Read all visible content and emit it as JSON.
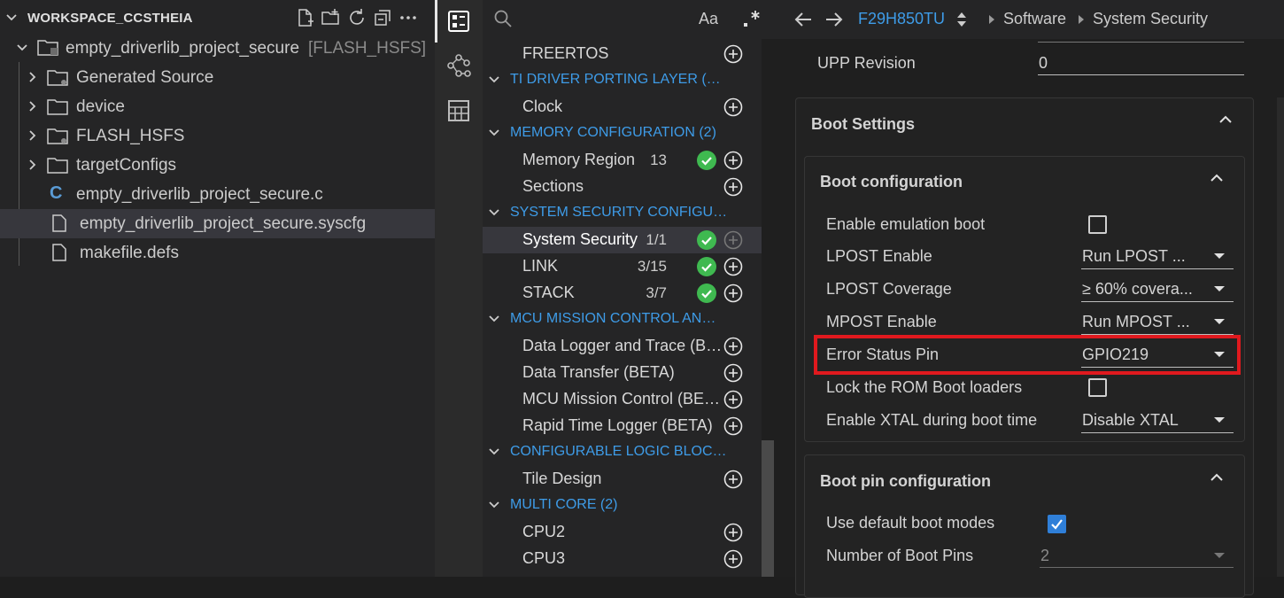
{
  "explorer": {
    "title": "WORKSPACE_CCSTHEIA",
    "project": {
      "name": "empty_driverlib_project_secure",
      "config": "[FLASH_HSFS]"
    },
    "items": [
      {
        "label": "Generated Source",
        "icon": "gear-folder-icon"
      },
      {
        "label": "device",
        "icon": "folder-icon"
      },
      {
        "label": "FLASH_HSFS",
        "icon": "gear-folder-icon"
      },
      {
        "label": "targetConfigs",
        "icon": "folder-icon"
      },
      {
        "label": "empty_driverlib_project_secure.c",
        "icon": "c-file-icon",
        "glyph": "C"
      },
      {
        "label": "empty_driverlib_project_secure.syscfg",
        "icon": "file-icon"
      },
      {
        "label": "makefile.defs",
        "icon": "file-icon"
      }
    ]
  },
  "modules": {
    "search_case_label": "Aa",
    "rows": [
      {
        "type": "item",
        "label": "FREERTOS"
      },
      {
        "type": "cat",
        "label": "TI DRIVER PORTING LAYER (…"
      },
      {
        "type": "item",
        "label": "Clock"
      },
      {
        "type": "cat",
        "label": "MEMORY CONFIGURATION (2)"
      },
      {
        "type": "item",
        "label": "Memory Region",
        "count": "13"
      },
      {
        "type": "item",
        "label": "Sections"
      },
      {
        "type": "cat",
        "label": "SYSTEM SECURITY CONFIGU…"
      },
      {
        "type": "item",
        "label": "System Security",
        "count": "1/1"
      },
      {
        "type": "item",
        "label": "LINK",
        "count": "3/15"
      },
      {
        "type": "item",
        "label": "STACK",
        "count": "3/7"
      },
      {
        "type": "cat",
        "label": "MCU MISSION CONTROL AN…"
      },
      {
        "type": "item",
        "label": "Data Logger and Trace (B…"
      },
      {
        "type": "item",
        "label": "Data Transfer (BETA)"
      },
      {
        "type": "item",
        "label": "MCU Mission Control (BE…"
      },
      {
        "type": "item",
        "label": "Rapid Time Logger (BETA)"
      },
      {
        "type": "cat",
        "label": "CONFIGURABLE LOGIC BLOC…"
      },
      {
        "type": "item",
        "label": "Tile Design"
      },
      {
        "type": "cat",
        "label": "MULTI CORE (2)"
      },
      {
        "type": "item",
        "label": "CPU2"
      },
      {
        "type": "item",
        "label": "CPU3"
      }
    ]
  },
  "header": {
    "device": "F29H850TU",
    "crumb1": "Software",
    "crumb2": "System Security"
  },
  "config": {
    "upp_revision": {
      "label": "UPP Revision",
      "value": "0"
    },
    "boot_settings_title": "Boot Settings",
    "boot_config_title": "Boot configuration",
    "enable_emulation_boot": {
      "label": "Enable emulation boot"
    },
    "lpost_enable": {
      "label": "LPOST Enable",
      "value": "Run LPOST ..."
    },
    "lpost_coverage": {
      "label": "LPOST Coverage",
      "value": "≥ 60% covera..."
    },
    "mpost_enable": {
      "label": "MPOST Enable",
      "value": "Run MPOST ..."
    },
    "error_status_pin": {
      "label": "Error Status Pin",
      "value": "GPIO219"
    },
    "lock_rom_bootloaders": {
      "label": "Lock the ROM Boot loaders"
    },
    "enable_xtal": {
      "label": "Enable XTAL during boot time",
      "value": "Disable XTAL"
    },
    "boot_pin_config_title": "Boot pin configuration",
    "use_default_boot_modes": {
      "label": "Use default boot modes"
    },
    "number_of_boot_pins": {
      "label": "Number of Boot Pins",
      "value": "2"
    }
  },
  "colors": {
    "accent": "#3e9ce8",
    "success": "#3fb950",
    "highlight": "#e0191e"
  }
}
